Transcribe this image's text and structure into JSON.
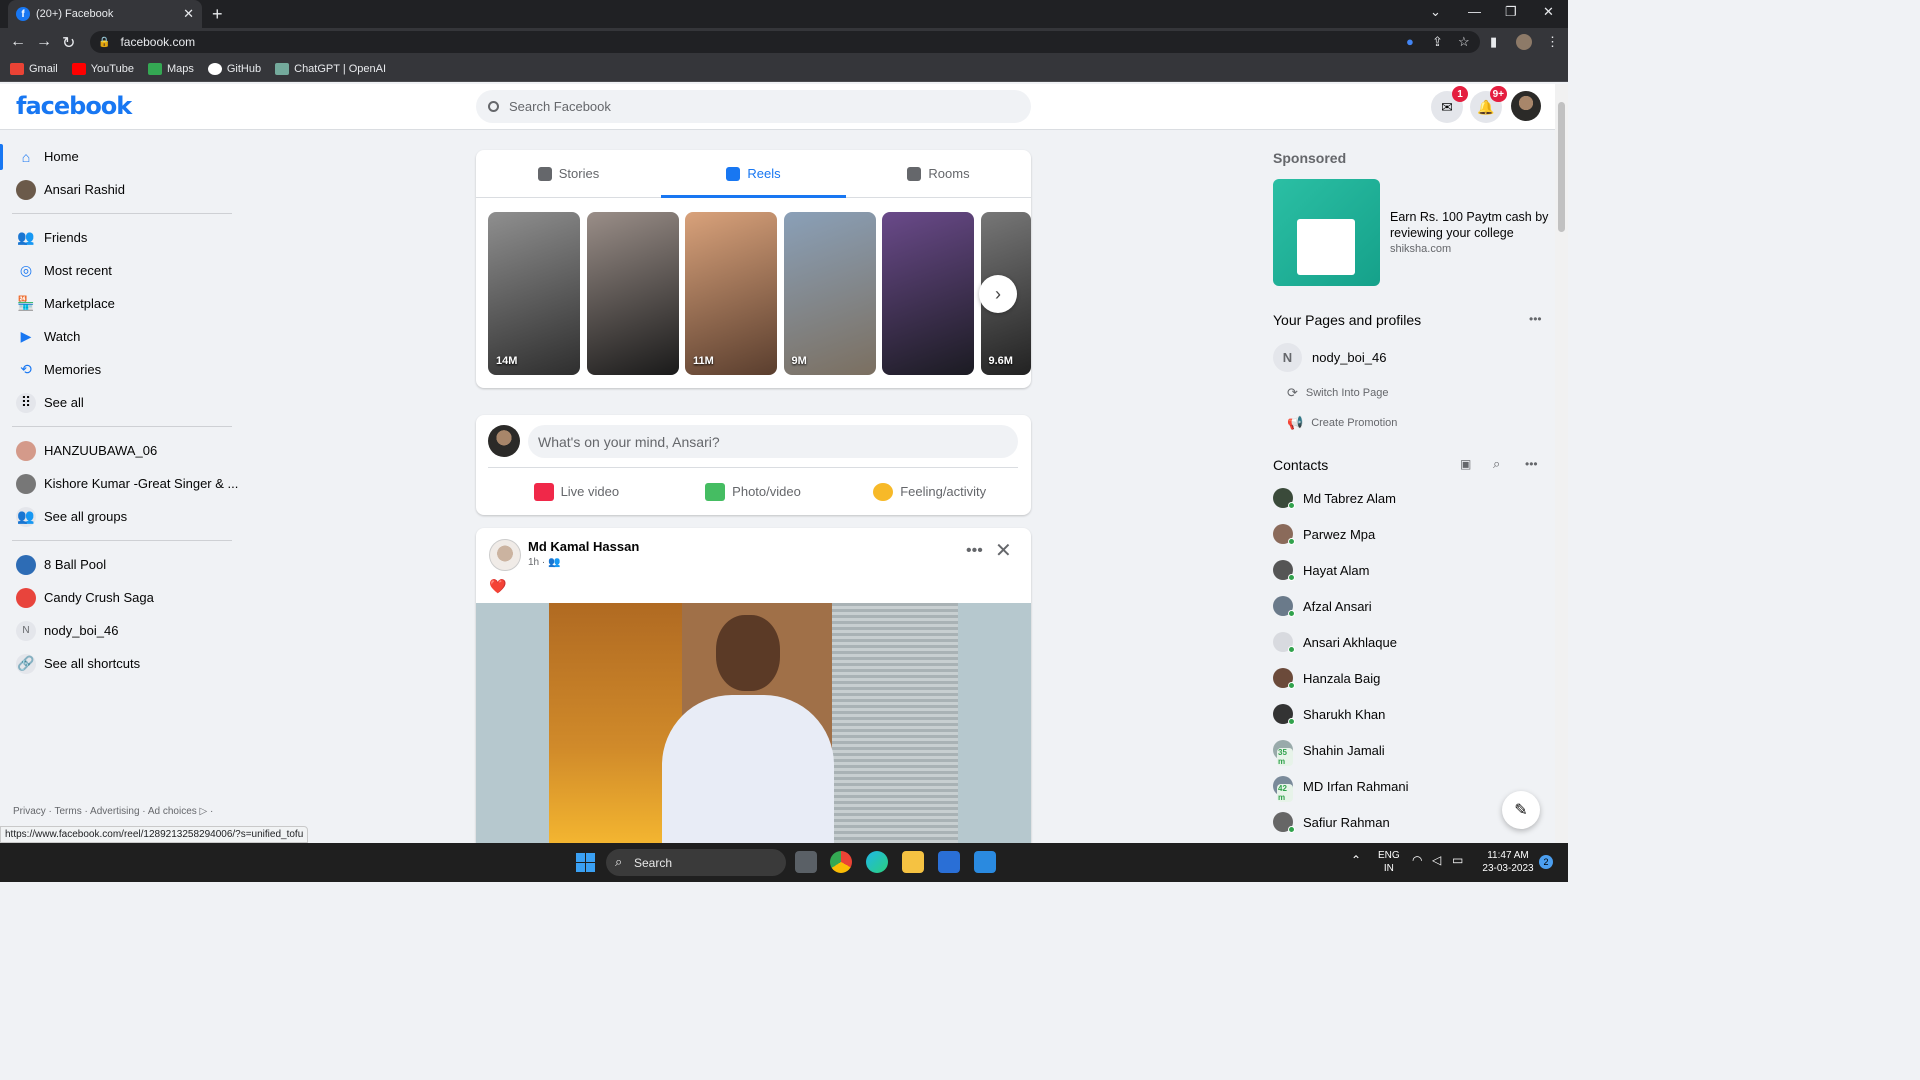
{
  "browser": {
    "tab_title": "(20+) Facebook",
    "url": "facebook.com",
    "bookmarks": [
      "Gmail",
      "YouTube",
      "Maps",
      "GitHub",
      "ChatGPT | OpenAI"
    ],
    "status_url": "https://www.facebook.com/reel/1289213258294006/?s=unified_tofu"
  },
  "header": {
    "logo": "facebook",
    "search_placeholder": "Search Facebook",
    "messenger_badge": "1",
    "notifications_badge": "9+"
  },
  "left_nav": {
    "items": [
      "Home",
      "Ansari Rashid",
      "Friends",
      "Most recent",
      "Marketplace",
      "Watch",
      "Memories",
      "See all"
    ],
    "groups": [
      "HANZUUBAWA_06",
      "Kishore Kumar -Great Singer & ...",
      "See all groups"
    ],
    "shortcuts": [
      "8 Ball Pool",
      "Candy Crush Saga",
      "nody_boi_46",
      "See all shortcuts"
    ],
    "footer": "Privacy · Terms · Advertising · Ad choices ▷ ·"
  },
  "stories": {
    "tabs": [
      "Stories",
      "Reels",
      "Rooms"
    ],
    "selected_tab": "Reels",
    "reels": [
      {
        "views": "14M",
        "colors": [
          "#8f8f8f",
          "#2e2e2e"
        ]
      },
      {
        "views": "",
        "colors": [
          "#9a8e88",
          "#1a1a1a"
        ]
      },
      {
        "views": "11M",
        "colors": [
          "#d9a27b",
          "#5a3e2e"
        ]
      },
      {
        "views": "9M",
        "colors": [
          "#8aa0b8",
          "#7b6f60"
        ]
      },
      {
        "views": "",
        "colors": [
          "#6a4a8a",
          "#1b1b22"
        ]
      },
      {
        "views": "9.6M",
        "colors": [
          "#777777",
          "#222222"
        ]
      }
    ]
  },
  "composer": {
    "placeholder": "What's on your mind, Ansari?",
    "actions": [
      "Live video",
      "Photo/video",
      "Feeling/activity"
    ]
  },
  "post": {
    "author": "Md Kamal Hassan",
    "time": "1h ·",
    "content": "❤️"
  },
  "right": {
    "sponsored_title": "Sponsored",
    "ad_text": "Earn Rs. 100 Paytm cash by reviewing your college",
    "ad_domain": "shiksha.com",
    "pages_title": "Your Pages and profiles",
    "page_name": "nody_boi_46",
    "page_actions": [
      "Switch Into Page",
      "Create Promotion"
    ],
    "contacts_title": "Contacts",
    "contacts": [
      {
        "name": "Md Tabrez Alam",
        "online": true,
        "mins": ""
      },
      {
        "name": "Parwez Mpa",
        "online": true,
        "mins": ""
      },
      {
        "name": "Hayat Alam",
        "online": true,
        "mins": ""
      },
      {
        "name": "Afzal Ansari",
        "online": true,
        "mins": ""
      },
      {
        "name": "Ansari Akhlaque",
        "online": true,
        "mins": ""
      },
      {
        "name": "Hanzala Baig",
        "online": true,
        "mins": ""
      },
      {
        "name": "Sharukh Khan",
        "online": true,
        "mins": ""
      },
      {
        "name": "Shahin Jamali",
        "online": false,
        "mins": "35 m"
      },
      {
        "name": "MD Irfan Rahmani",
        "online": false,
        "mins": "42 m"
      },
      {
        "name": "Safiur Rahman",
        "online": true,
        "mins": ""
      }
    ]
  },
  "taskbar": {
    "search_label": "Search",
    "lang_line1": "ENG",
    "lang_line2": "IN",
    "time": "11:47 AM",
    "date": "23-03-2023",
    "notif_count": "2"
  }
}
